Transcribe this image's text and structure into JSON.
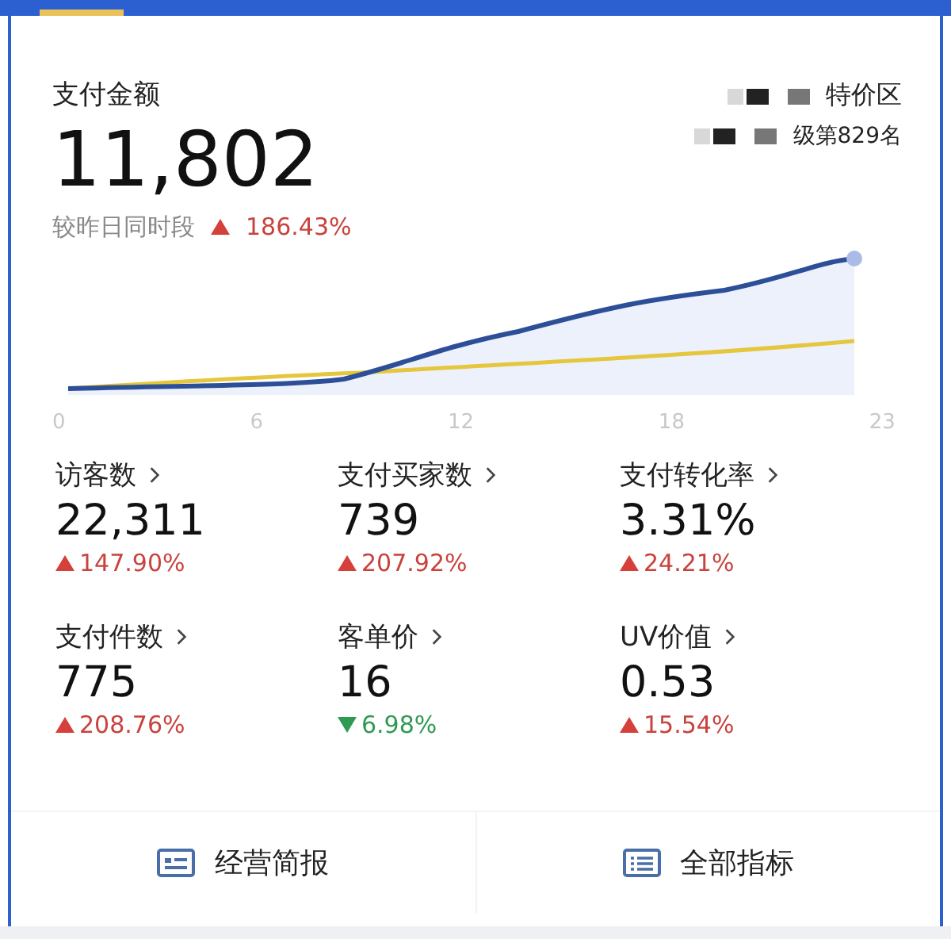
{
  "header": {
    "tab_selected": true
  },
  "summary": {
    "label": "支付金额",
    "value": "11,802",
    "compare_label": "较昨日同时段",
    "change": {
      "kind": "up",
      "text": "186.43%"
    },
    "rank_lines": [
      {
        "text": "特价区",
        "redacted": true
      },
      {
        "text": "级第829名",
        "redacted": true
      }
    ]
  },
  "chart": {
    "x_labels": [
      "0",
      "6",
      "12",
      "18",
      "23"
    ]
  },
  "metrics": [
    {
      "label": "访客数",
      "value": "22,311",
      "kind": "up",
      "change": "147.90%"
    },
    {
      "label": "支付买家数",
      "value": "739",
      "kind": "up",
      "change": "207.92%"
    },
    {
      "label": "支付转化率",
      "value": "3.31%",
      "kind": "up",
      "change": "24.21%"
    },
    {
      "label": "支付件数",
      "value": "775",
      "kind": "up",
      "change": "208.76%"
    },
    {
      "label": "客单价",
      "value": "16",
      "kind": "down",
      "change": "6.98%"
    },
    {
      "label": "UV价值",
      "value": "0.53",
      "kind": "up",
      "change": "15.54%"
    }
  ],
  "actions": [
    {
      "label": "经营简报",
      "kind": "card"
    },
    {
      "label": "全部指标",
      "kind": "list"
    }
  ]
}
